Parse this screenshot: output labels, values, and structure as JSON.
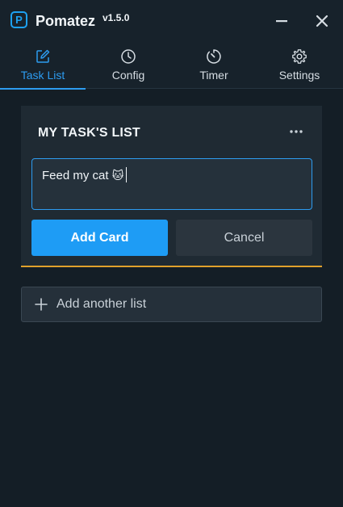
{
  "app": {
    "logo_letter": "P",
    "name": "Pomatez",
    "version": "v1.5.0"
  },
  "nav": {
    "tabs": [
      {
        "label": "Task List",
        "icon": "edit-icon",
        "active": true
      },
      {
        "label": "Config",
        "icon": "clock-icon",
        "active": false
      },
      {
        "label": "Timer",
        "icon": "timer-icon",
        "active": false
      },
      {
        "label": "Settings",
        "icon": "gear-icon",
        "active": false
      }
    ]
  },
  "list": {
    "title": "MY TASK'S LIST",
    "card_input_value": "Feed my cat",
    "card_input_emoji": "🐱",
    "add_card_label": "Add Card",
    "cancel_label": "Cancel"
  },
  "add_list": {
    "label": "Add another list"
  },
  "colors": {
    "accent": "#2d9cf0",
    "list_underline": "#e0a12b",
    "background": "#141e26"
  }
}
